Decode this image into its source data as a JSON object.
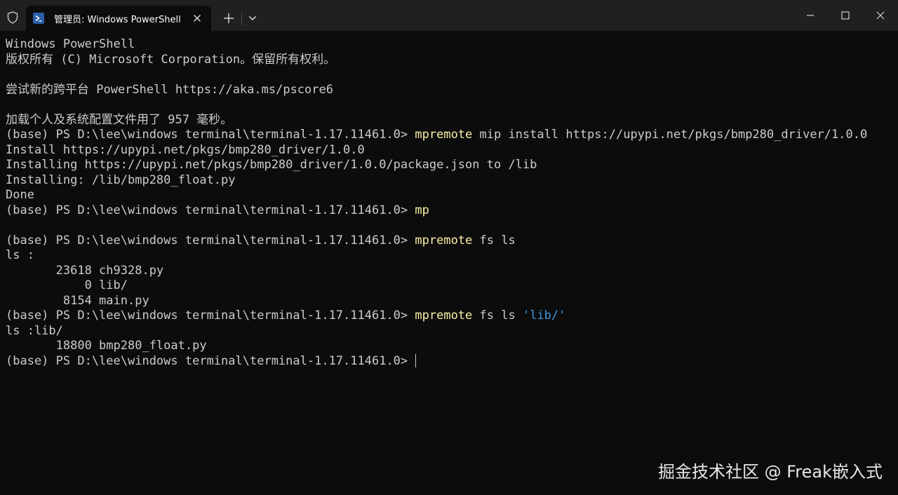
{
  "titlebar": {
    "tab_title": "管理员: Windows PowerShell",
    "icons": {
      "shield": "shield-icon",
      "tab": "powershell-icon",
      "close_tab": "close-icon",
      "new_tab": "plus-icon",
      "dropdown": "chevron-down-icon",
      "minimize": "minimize-icon",
      "maximize": "maximize-icon",
      "close_window": "close-icon"
    }
  },
  "terminal": {
    "colors": {
      "background": "#0c0c0c",
      "text": "#cccccc",
      "command": "#f9f1a5",
      "string": "#3a96dd"
    },
    "lines": [
      {
        "text": "Windows PowerShell"
      },
      {
        "text": "版权所有 (C) Microsoft Corporation。保留所有权利。"
      },
      {
        "text": ""
      },
      {
        "text": "尝试新的跨平台 PowerShell https://aka.ms/pscore6"
      },
      {
        "text": ""
      },
      {
        "text": "加载个人及系统配置文件用了 957 毫秒。"
      },
      {
        "prompt": "(base) PS D:\\lee\\windows terminal\\terminal-1.17.11461.0> ",
        "cmd": "mpremote",
        "args": " mip install https://upypi.net/pkgs/bmp280_driver/1.0.0"
      },
      {
        "text": "Install https://upypi.net/pkgs/bmp280_driver/1.0.0"
      },
      {
        "text": "Installing https://upypi.net/pkgs/bmp280_driver/1.0.0/package.json to /lib"
      },
      {
        "text": "Installing: /lib/bmp280_float.py"
      },
      {
        "text": "Done"
      },
      {
        "prompt": "(base) PS D:\\lee\\windows terminal\\terminal-1.17.11461.0> ",
        "cmd": "mp"
      },
      {
        "text": ""
      },
      {
        "prompt": "(base) PS D:\\lee\\windows terminal\\terminal-1.17.11461.0> ",
        "cmd": "mpremote",
        "args": " fs ls"
      },
      {
        "text": "ls :"
      },
      {
        "text": "       23618 ch9328.py"
      },
      {
        "text": "           0 lib/"
      },
      {
        "text": "        8154 main.py"
      },
      {
        "prompt": "(base) PS D:\\lee\\windows terminal\\terminal-1.17.11461.0> ",
        "cmd": "mpremote",
        "args": " fs ls ",
        "str": "'lib/'"
      },
      {
        "text": "ls :lib/"
      },
      {
        "text": "       18800 bmp280_float.py"
      },
      {
        "prompt": "(base) PS D:\\lee\\windows terminal\\terminal-1.17.11461.0> ",
        "cursor": true
      }
    ]
  },
  "watermark": "掘金技术社区 @ Freak嵌入式"
}
